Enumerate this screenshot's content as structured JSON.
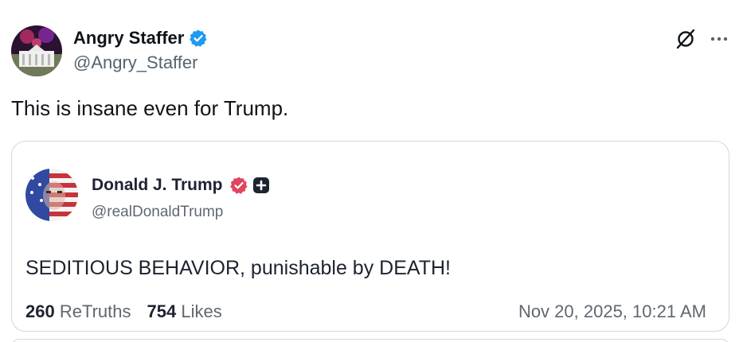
{
  "tweet": {
    "author": {
      "display_name": "Angry Staffer",
      "handle": "@Angry_Staffer",
      "avatar_icon": "white-house-fireworks-avatar",
      "verified": true,
      "verified_color": "#1d9bf0"
    },
    "text": "This is insane even for Trump.",
    "actions": {
      "grok_icon": "grok-icon",
      "more_icon": "more-icon"
    }
  },
  "quote": {
    "author": {
      "display_name": "Donald J. Trump",
      "handle": "@realDonaldTrump",
      "avatar_icon": "flag-face-avatar",
      "verified": true,
      "verified_color": "#e0445e",
      "plus_badge_icon": "plus-badge-icon"
    },
    "text": "SEDITIOUS BEHAVIOR, punishable by DEATH!",
    "retruths_count": "260",
    "retruths_label": "ReTruths",
    "likes_count": "754",
    "likes_label": "Likes",
    "timestamp": "Nov 20, 2025, 10:21 AM"
  }
}
